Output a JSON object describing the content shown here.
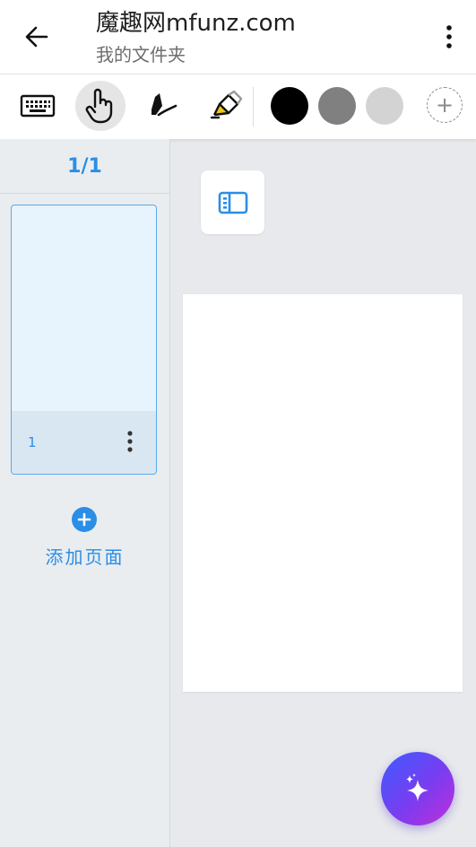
{
  "header": {
    "title": "魔趣网mfunz.com",
    "subtitle": "我的文件夹",
    "back_icon": "arrow-left-icon",
    "more_icon": "more-vertical-icon"
  },
  "toolbar": {
    "tools": [
      "keyboard-icon",
      "hand-pointer-icon",
      "pen-icon",
      "highlighter-icon"
    ],
    "active_tool": "hand-pointer-icon",
    "colors": [
      "#000000",
      "#808080",
      "#d3d3d3"
    ],
    "add_color_label": "+"
  },
  "sidebar": {
    "page_count": "1/1",
    "thumbnails": [
      {
        "number": "1"
      }
    ],
    "add_page_label": "添加页面"
  },
  "accent_color": "#2a8ee6"
}
